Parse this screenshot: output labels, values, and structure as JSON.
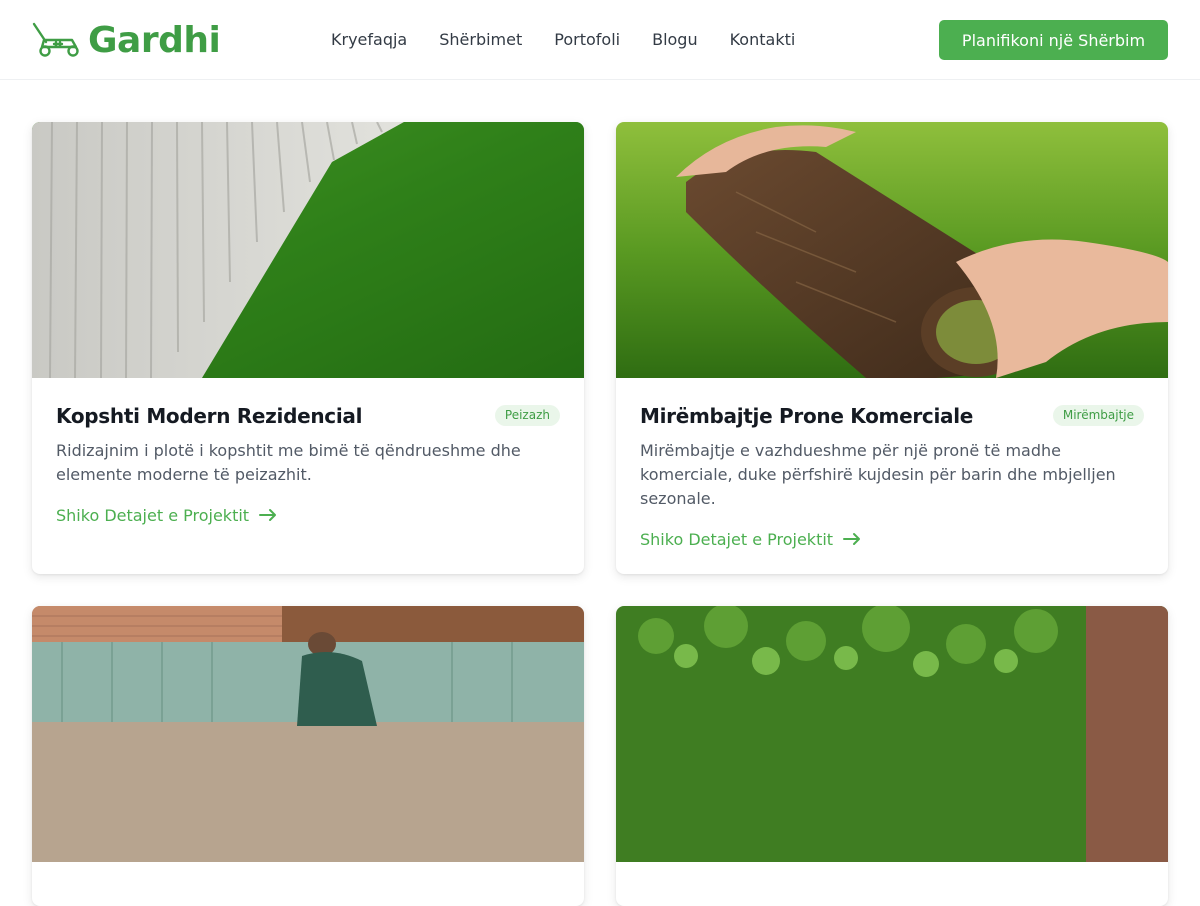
{
  "brand": {
    "name": "Gardhi",
    "accent": "#4caf50",
    "logo_icon": "lawn-mower-icon"
  },
  "nav": {
    "items": [
      "Kryefaqja",
      "Shërbimet",
      "Portofoli",
      "Blogu",
      "Kontakti"
    ]
  },
  "header": {
    "cta_label": "Planifikoni një Shërbim"
  },
  "projects": [
    {
      "title": "Kopshti Modern Rezidencial",
      "badge": "Peizazh",
      "description": "Ridizajnim i plotë i kopshtit me bimë të qëndrueshme dhe elemente moderne të peizazhit.",
      "link": "Shiko Detajet e Projektit",
      "image": "lawn-beside-wooden-fence"
    },
    {
      "title": "Mirëmbajtje Prone Komerciale",
      "badge": "Mirëmbajtje",
      "description": "Mirëmbajtje e vazhdueshme për një pronë të madhe komerciale, duke përfshirë kujdesin për barin dhe mbjelljen sezonale.",
      "link": "Shiko Detajet e Projektit",
      "image": "hands-rolling-sod"
    },
    {
      "image": "gardener-working-backyard"
    },
    {
      "image": "green-groundcover-garden"
    }
  ]
}
